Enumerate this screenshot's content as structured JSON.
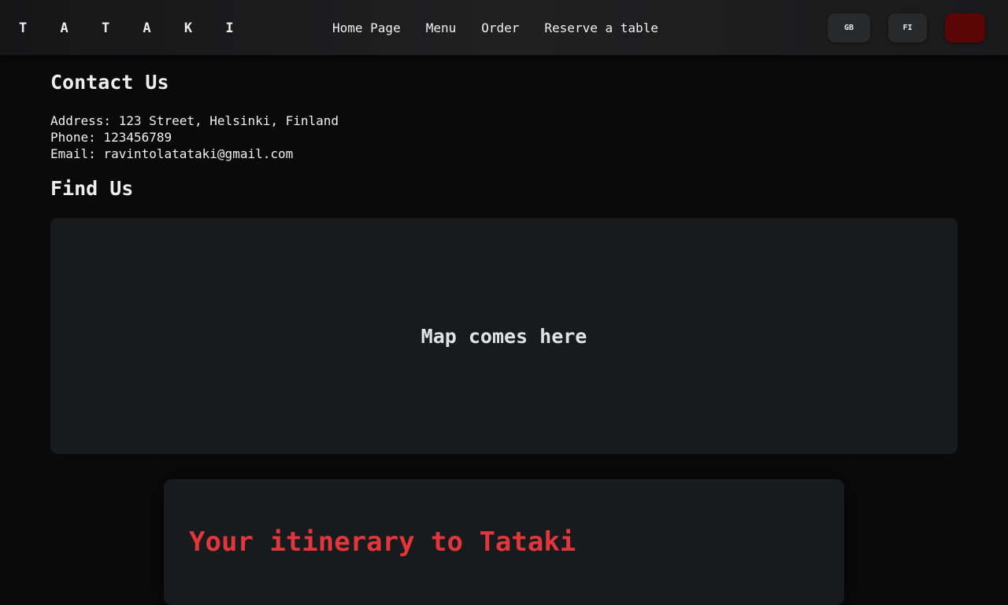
{
  "header": {
    "logo": "T A T A K I",
    "nav": {
      "home": "Home Page",
      "menu": "Menu",
      "order": "Order",
      "reserve": "Reserve a table"
    },
    "languages": {
      "gb": "GB",
      "fi": "FI"
    },
    "cart_color": "#5c0506"
  },
  "contact": {
    "title": "Contact Us",
    "address": "Address: 123 Street, Helsinki, Finland",
    "phone": "Phone: 123456789",
    "email": "Email: ravintolatataki@gmail.com"
  },
  "find": {
    "title": "Find Us",
    "map_placeholder": "Map comes here"
  },
  "itinerary": {
    "title": "Your itinerary to Tataki",
    "title_color": "#e2363a"
  }
}
